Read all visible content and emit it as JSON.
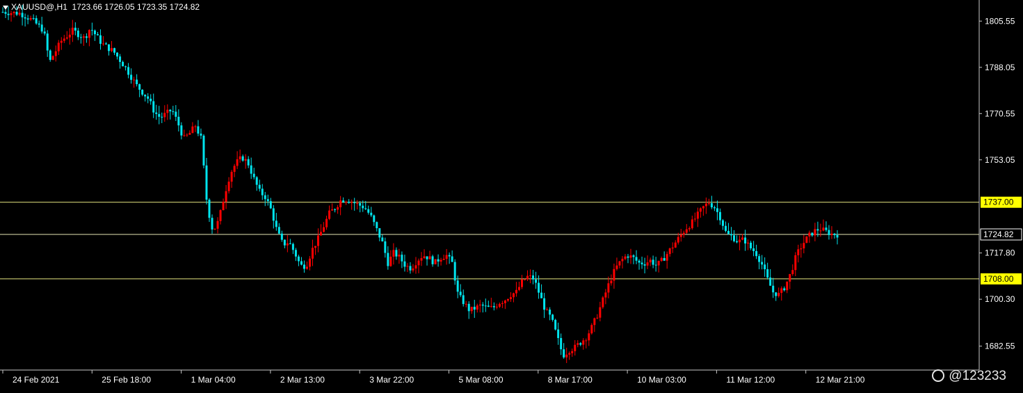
{
  "header": {
    "symbol": "XAUUSD@,H1",
    "ohlc": "1723.66 1726.05 1723.35 1724.82"
  },
  "watermark": "@123233",
  "colors": {
    "background": "#000000",
    "axis": "#c8c8c8",
    "bull": "#ff0000",
    "bear": "#00e5ee",
    "level_line": "#e6e680",
    "price_line": "#e6e6b4",
    "level_tag_bg": "#ffff00",
    "price_tag_bg": "#000000"
  },
  "chart_data": {
    "type": "candlestick",
    "ylim": [
      1673.5,
      1813.0
    ],
    "y_ticks": [
      "1805.55",
      "1788.05",
      "1770.55",
      "1753.05",
      "1717.80",
      "1700.30",
      "1682.55"
    ],
    "x_ticks": [
      "24 Feb 2021",
      "25 Feb 18:00",
      "1 Mar 04:00",
      "2 Mar 13:00",
      "3 Mar 22:00",
      "5 Mar 08:00",
      "8 Mar 17:00",
      "10 Mar 03:00",
      "11 Mar 12:00",
      "12 Mar 21:00"
    ],
    "levels": [
      {
        "value": 1737.0,
        "label": "1737.00"
      },
      {
        "value": 1708.0,
        "label": "1708.00"
      }
    ],
    "current_price": {
      "value": 1724.82,
      "label": "1724.82"
    },
    "close_path": [
      [
        0,
        1809
      ],
      [
        3,
        1808.5
      ],
      [
        5,
        1806
      ],
      [
        7,
        1802
      ],
      [
        8,
        1790
      ],
      [
        9,
        1794
      ],
      [
        10,
        1798
      ],
      [
        12,
        1802
      ],
      [
        14,
        1799
      ],
      [
        15,
        1803
      ],
      [
        17,
        1797
      ],
      [
        19,
        1794
      ],
      [
        21,
        1788
      ],
      [
        23,
        1781
      ],
      [
        25,
        1776
      ],
      [
        26,
        1771
      ],
      [
        27,
        1769
      ],
      [
        29,
        1772
      ],
      [
        30,
        1767
      ],
      [
        31,
        1761
      ],
      [
        32,
        1763
      ],
      [
        33,
        1766
      ],
      [
        34,
        1761
      ],
      [
        35,
        1736
      ],
      [
        36,
        1726
      ],
      [
        37,
        1730
      ],
      [
        38,
        1740
      ],
      [
        39,
        1748
      ],
      [
        40,
        1752
      ],
      [
        41,
        1754
      ],
      [
        42,
        1752
      ],
      [
        43,
        1746
      ],
      [
        44,
        1741
      ],
      [
        45,
        1739
      ],
      [
        46,
        1734
      ],
      [
        47,
        1726
      ],
      [
        48,
        1721
      ],
      [
        49,
        1722
      ],
      [
        50,
        1718
      ],
      [
        51,
        1713
      ],
      [
        52,
        1713
      ],
      [
        53,
        1719
      ],
      [
        54,
        1723
      ],
      [
        55,
        1728
      ],
      [
        56,
        1733
      ],
      [
        57,
        1735
      ],
      [
        58,
        1738
      ],
      [
        59,
        1738
      ],
      [
        60,
        1737
      ],
      [
        61,
        1736
      ],
      [
        62,
        1735
      ],
      [
        63,
        1732
      ],
      [
        64,
        1727
      ],
      [
        65,
        1722
      ],
      [
        66,
        1714
      ],
      [
        67,
        1718
      ],
      [
        68,
        1716
      ],
      [
        69,
        1713
      ],
      [
        70,
        1712
      ],
      [
        71,
        1715
      ],
      [
        72,
        1717
      ],
      [
        73,
        1716
      ],
      [
        74,
        1714
      ],
      [
        75,
        1716
      ],
      [
        76,
        1717
      ],
      [
        77,
        1714
      ],
      [
        78,
        1702
      ],
      [
        79,
        1699
      ],
      [
        80,
        1696
      ],
      [
        81,
        1697
      ],
      [
        82,
        1698
      ],
      [
        83,
        1697
      ],
      [
        84,
        1697
      ],
      [
        85,
        1699
      ],
      [
        86,
        1700
      ],
      [
        87,
        1702
      ],
      [
        88,
        1703
      ],
      [
        89,
        1707
      ],
      [
        90,
        1709
      ],
      [
        91,
        1708
      ],
      [
        92,
        1702
      ],
      [
        93,
        1696
      ],
      [
        94,
        1693
      ],
      [
        95,
        1686
      ],
      [
        96,
        1679
      ],
      [
        97,
        1681
      ],
      [
        98,
        1682
      ],
      [
        99,
        1684
      ],
      [
        100,
        1686
      ],
      [
        101,
        1690
      ],
      [
        102,
        1695
      ],
      [
        103,
        1701
      ],
      [
        104,
        1707
      ],
      [
        105,
        1712
      ],
      [
        106,
        1715
      ],
      [
        107,
        1717
      ],
      [
        108,
        1716
      ],
      [
        109,
        1714
      ],
      [
        110,
        1714
      ],
      [
        111,
        1715
      ],
      [
        112,
        1713
      ],
      [
        113,
        1715
      ],
      [
        114,
        1718
      ],
      [
        115,
        1721
      ],
      [
        116,
        1724
      ],
      [
        117,
        1727
      ],
      [
        118,
        1729
      ],
      [
        119,
        1732
      ],
      [
        120,
        1735
      ],
      [
        121,
        1737
      ],
      [
        122,
        1735
      ],
      [
        123,
        1731
      ],
      [
        124,
        1725
      ],
      [
        125,
        1724
      ],
      [
        126,
        1722
      ],
      [
        127,
        1723
      ],
      [
        128,
        1720
      ],
      [
        129,
        1718
      ],
      [
        130,
        1714
      ],
      [
        131,
        1708
      ],
      [
        132,
        1703
      ],
      [
        133,
        1702
      ],
      [
        134,
        1705
      ],
      [
        135,
        1710
      ],
      [
        136,
        1717
      ],
      [
        137,
        1721
      ],
      [
        138,
        1724
      ],
      [
        139,
        1726
      ],
      [
        140,
        1727
      ],
      [
        141,
        1726
      ],
      [
        142,
        1725
      ],
      [
        143,
        1724.82
      ]
    ]
  }
}
